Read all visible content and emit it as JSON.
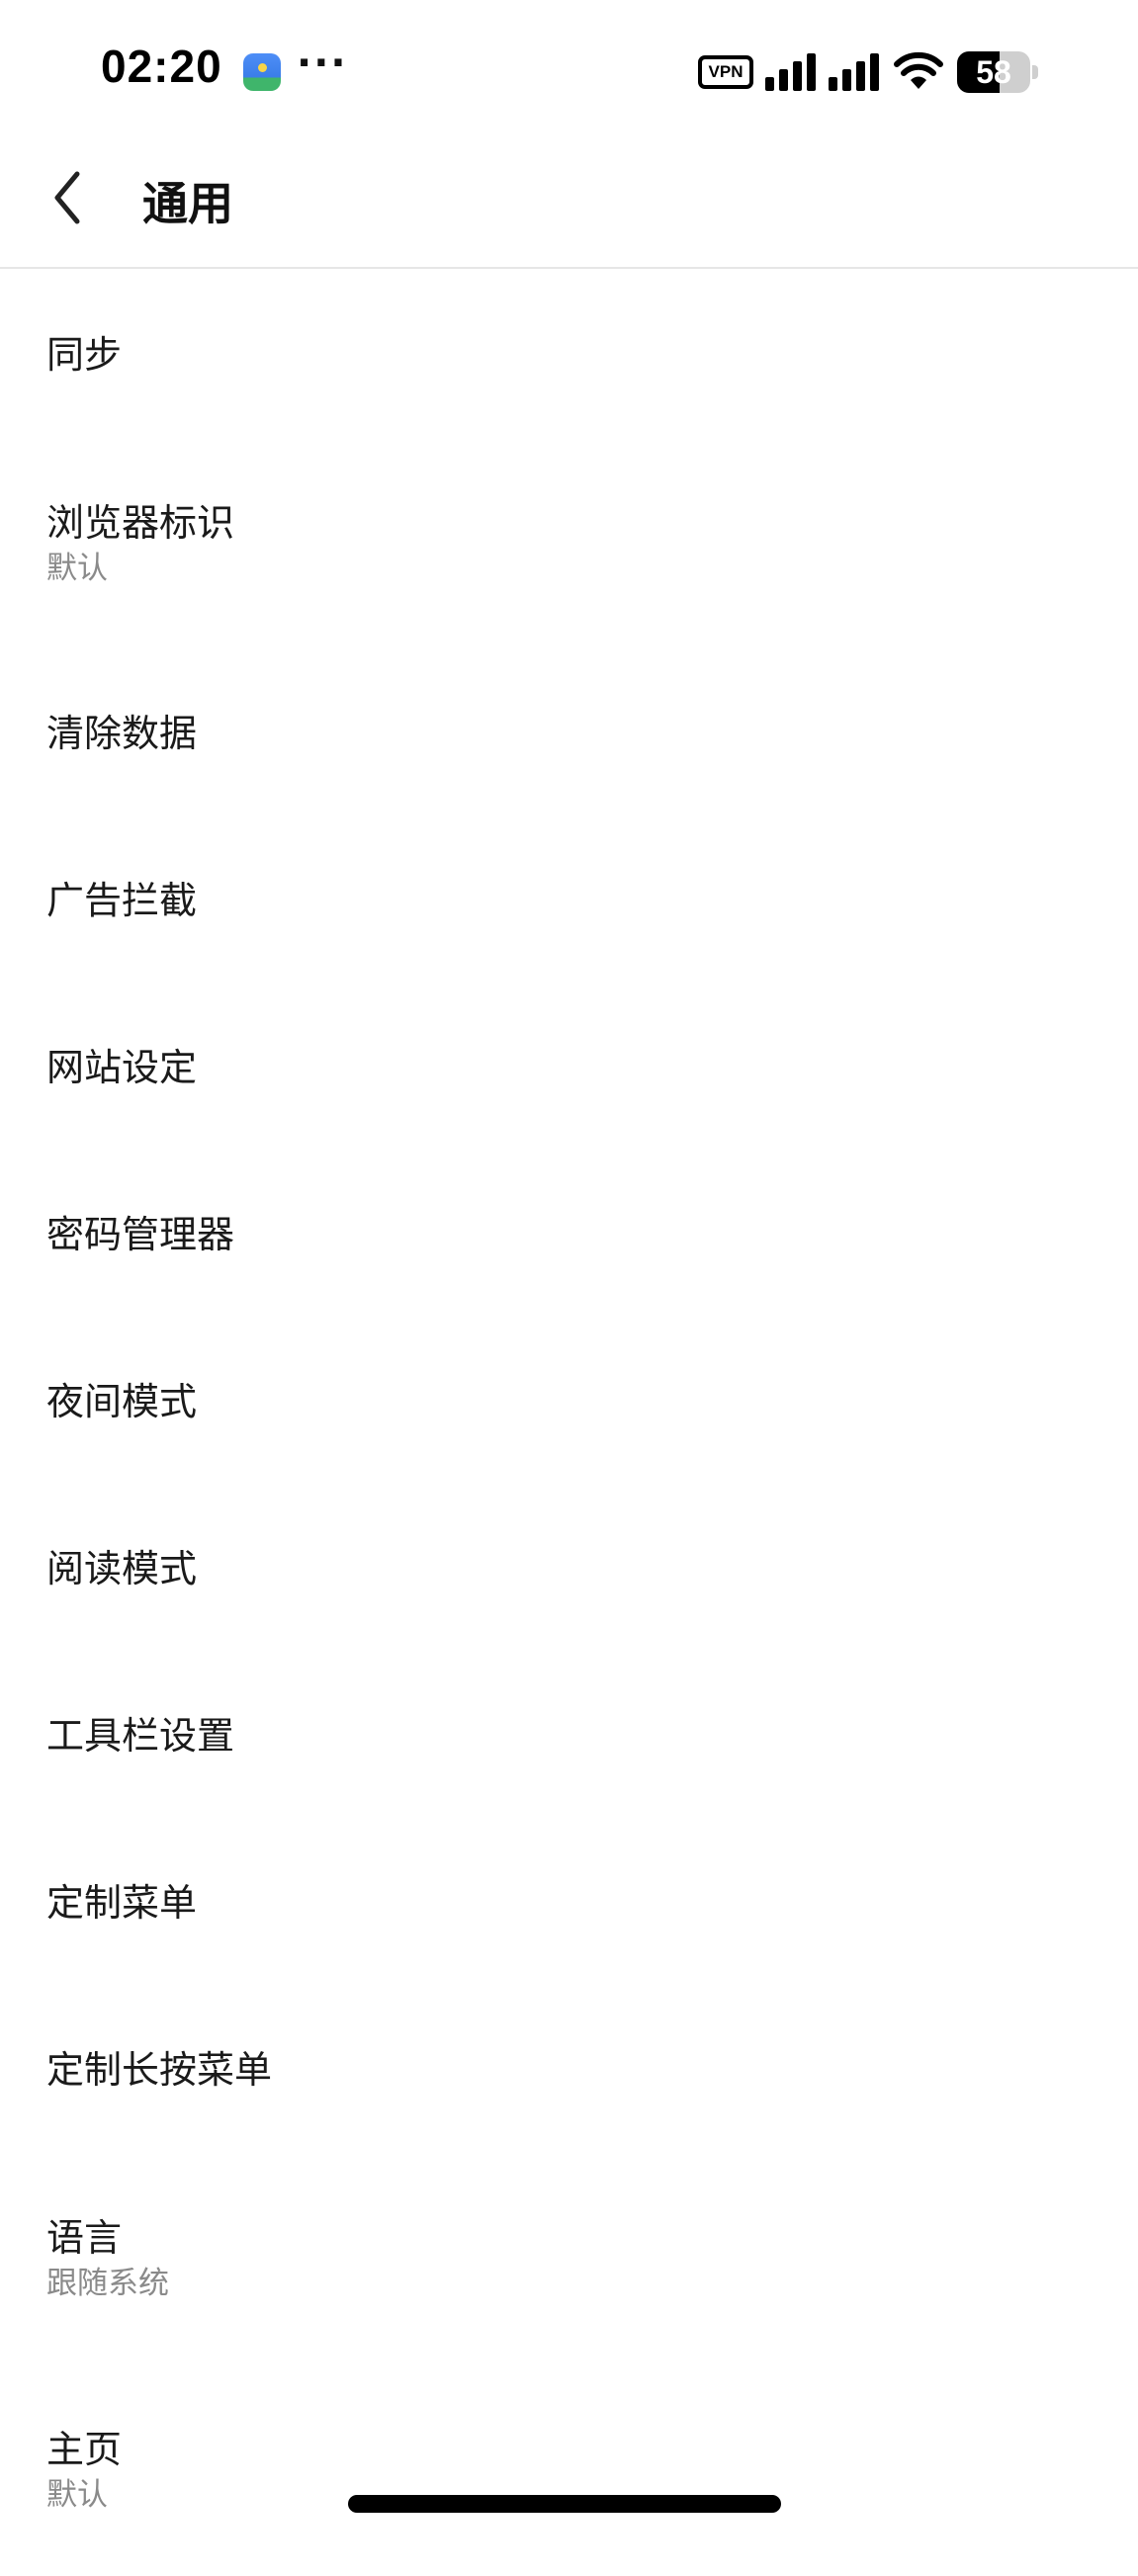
{
  "status_bar": {
    "time": "02:20",
    "more_indicator": "···",
    "vpn_label": "VPN",
    "battery_level": "58",
    "battery_fraction": 0.58,
    "icons": [
      "notification-app-icon",
      "vpn-icon",
      "signal-icon",
      "wifi-icon",
      "battery-icon"
    ]
  },
  "header": {
    "title": "通用",
    "back_icon": "chevron-left-icon"
  },
  "settings": {
    "items": [
      {
        "label": "同步"
      },
      {
        "label": "浏览器标识",
        "sub": "默认"
      },
      {
        "label": "清除数据"
      },
      {
        "label": "广告拦截"
      },
      {
        "label": "网站设定"
      },
      {
        "label": "密码管理器"
      },
      {
        "label": "夜间模式"
      },
      {
        "label": "阅读模式"
      },
      {
        "label": "工具栏设置"
      },
      {
        "label": "定制菜单"
      },
      {
        "label": "定制长按菜单"
      },
      {
        "label": "语言",
        "sub": "跟随系统"
      },
      {
        "label": "主页",
        "sub": "默认"
      }
    ]
  }
}
